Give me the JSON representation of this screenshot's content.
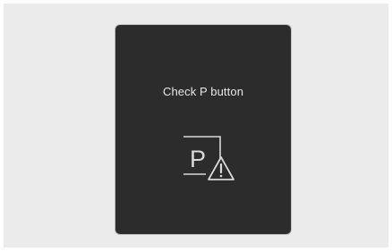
{
  "warning": {
    "message": "Check P button",
    "icon": "park-button-warning-icon",
    "icon_letter": "P"
  },
  "colors": {
    "background": "#ebebeb",
    "panel": "#2c2c2c",
    "text": "#e6e6e6"
  }
}
